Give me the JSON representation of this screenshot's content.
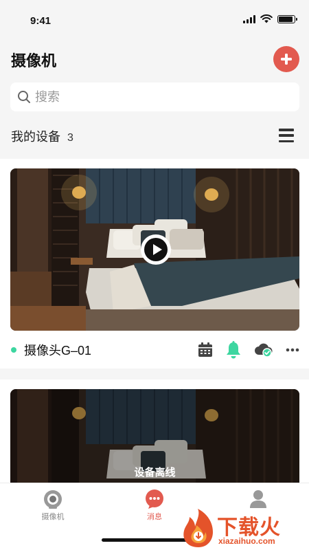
{
  "status_bar": {
    "time": "9:41"
  },
  "header": {
    "title": "摄像机"
  },
  "search": {
    "placeholder": "搜索"
  },
  "devices_section": {
    "title": "我的设备",
    "count": "3"
  },
  "devices": [
    {
      "name": "摄像头G–01",
      "status": "online"
    },
    {
      "status_label": "设备离线"
    }
  ],
  "colors": {
    "accent": "#e25a4f",
    "online": "#3dd6a0"
  },
  "tabs": [
    {
      "label": "摄像机",
      "icon": "camera-icon",
      "active": false
    },
    {
      "label": "消息",
      "icon": "message-icon",
      "active": true
    },
    {
      "label": "",
      "icon": "profile-icon",
      "active": false
    }
  ],
  "watermark": {
    "text": "下载火",
    "domain": "xiazaihuo.com"
  }
}
